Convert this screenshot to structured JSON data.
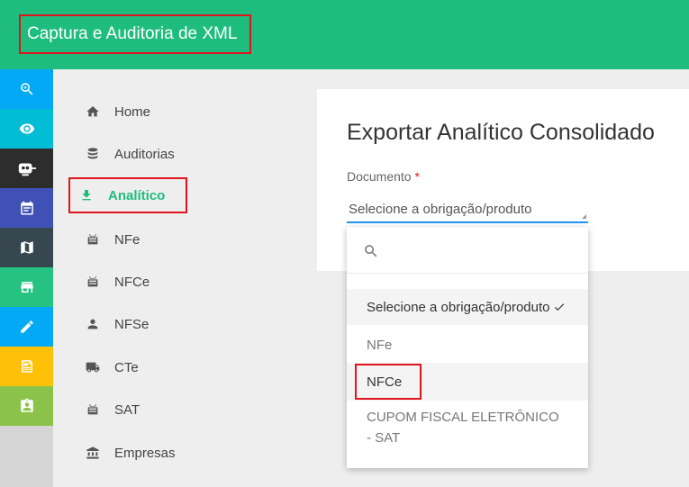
{
  "header": {
    "title": "Captura e Auditoria de XML",
    "bg_color": "#1ebd7e"
  },
  "rail": [
    {
      "icon": "zoom-in-icon",
      "color": "#03a9f4"
    },
    {
      "icon": "eye-icon",
      "color": "#00bcd4"
    },
    {
      "icon": "robot-icon",
      "color": "#2d2d2d"
    },
    {
      "icon": "calendar-icon",
      "color": "#3f51b5"
    },
    {
      "icon": "map-icon",
      "color": "#37474f"
    },
    {
      "icon": "store-icon",
      "color": "#26c281"
    },
    {
      "icon": "pencil-icon",
      "color": "#03a9f4"
    },
    {
      "icon": "news-icon",
      "color": "#ffc107"
    },
    {
      "icon": "clipboard-account-icon",
      "color": "#8bc34a"
    }
  ],
  "sidenav": {
    "items": [
      {
        "label": "Home",
        "icon": "home-icon"
      },
      {
        "label": "Auditorias",
        "icon": "database-icon"
      },
      {
        "label": "Analítico",
        "icon": "download-icon",
        "active": true
      },
      {
        "label": "NFe",
        "icon": "receipt-icon"
      },
      {
        "label": "NFCe",
        "icon": "receipt-icon"
      },
      {
        "label": "NFSe",
        "icon": "person-icon"
      },
      {
        "label": "CTe",
        "icon": "truck-icon"
      },
      {
        "label": "SAT",
        "icon": "receipt-icon"
      },
      {
        "label": "Empresas",
        "icon": "bank-icon"
      }
    ]
  },
  "main": {
    "title": "Exportar Analítico Consolidado",
    "field_label": "Documento",
    "required_mark": "*",
    "select_value": "Selecione a obrigação/produto"
  },
  "dropdown": {
    "search_placeholder": "",
    "options": [
      {
        "label": "Selecione a obrigação/produto",
        "selected": true
      },
      {
        "label": "NFe"
      },
      {
        "label": "NFCe",
        "highlighted": true
      },
      {
        "label": "CUPOM FISCAL ELETRÔNICO - SAT"
      }
    ]
  }
}
